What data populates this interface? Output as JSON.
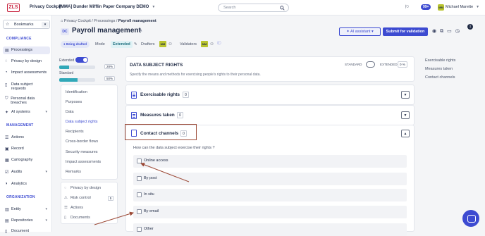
{
  "topbar": {
    "logo": "ZLS",
    "app_name": "Privacy Cockpit",
    "company": "[MMA] Dunder Mifflin Paper Company DEMO",
    "search_placeholder": "Search",
    "notifications_badge": "99+",
    "user_initials": "MM",
    "user_name": "Michael Marette"
  },
  "sidebar": {
    "bookmarks_label": "Bookmarks",
    "sections": [
      {
        "title": "COMPLIANCE",
        "items": [
          "Processings",
          "Privacy by design",
          "Impact assessments",
          "Data subject requests",
          "Personal data breaches",
          "AI systems"
        ]
      },
      {
        "title": "MANAGEMENT",
        "items": [
          "Actions",
          "Record",
          "Cartography",
          "Audits",
          "Analytics"
        ]
      },
      {
        "title": "ORGANIZATION",
        "items": [
          "Entity",
          "Repositories",
          "Document"
        ]
      }
    ]
  },
  "header": {
    "breadcrumb": [
      "Privacy Cockpit",
      "Processings",
      "Payroll management"
    ],
    "code": "DC",
    "title": "Payroll management",
    "ai_button": "AI assistant",
    "submit_button": "Submit for validation",
    "notif_count": "1",
    "status": "Being drafted",
    "mode_label": "Mode",
    "mode_value": "Extended",
    "drafters_label": "Drafters",
    "validators_label": "Validators",
    "mm": "MM"
  },
  "progress": {
    "extended_label": "Extended",
    "standard_label": "Standard",
    "extended_pct": "28%",
    "standard_pct": "50%",
    "extended_value": 28,
    "standard_value": 50
  },
  "menu": {
    "items": [
      "Identification",
      "Purposes",
      "Data",
      "Data subject rights",
      "Recipients",
      "Cross-border flows",
      "Security measures",
      "Impact assessments",
      "Remarks"
    ],
    "active": "Data subject rights",
    "bottom": [
      {
        "label": "Privacy by design",
        "icon": "bulb-icon"
      },
      {
        "label": "Risk control",
        "icon": "warning-icon",
        "count": "5"
      },
      {
        "label": "Actions",
        "icon": "list-icon"
      },
      {
        "label": "Documents",
        "icon": "file-icon"
      }
    ]
  },
  "panel": {
    "title": "DATA SUBJECT RIGHTS",
    "description": "Specify the means and methods for exercising people's rights to their personal data.",
    "standard_label": "STANDARD",
    "extended_label": "EXTENDED",
    "extended_pct": "0 %"
  },
  "sections": [
    {
      "title": "Exercisable rights",
      "count": "0",
      "expanded": false
    },
    {
      "title": "Measures taken",
      "count": "0",
      "expanded": false
    },
    {
      "title": "Contact channels",
      "count": "0",
      "expanded": true
    }
  ],
  "contact": {
    "question": "How can the data subject exercise their rights ?",
    "options": [
      "Online access",
      "By post",
      "In situ",
      "By email",
      "Other"
    ]
  },
  "toc": [
    "Exercisable rights",
    "Measures taken",
    "Contact channels"
  ],
  "colors": {
    "accent": "#3d4bd1",
    "teal": "#31a8b8",
    "highlight": "#9c4a37",
    "logo": "#c8233f"
  }
}
